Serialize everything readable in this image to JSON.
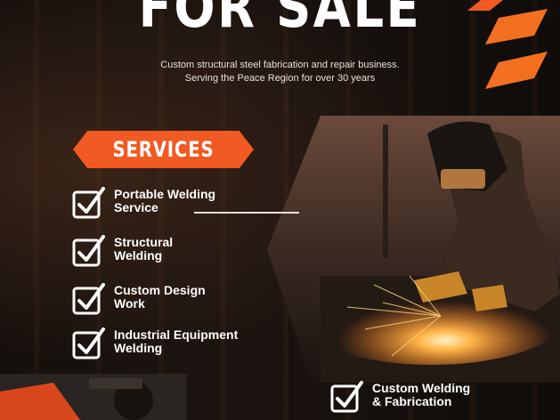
{
  "poster": {
    "headline": "FOR SALE",
    "description_line1": "Custom structural steel fabrication and repair business.",
    "description_line2": "Serving the Peace Region for over 30 years",
    "services_badge": "SERVICES",
    "services": [
      {
        "line1": "Portable Welding",
        "line2": "Service"
      },
      {
        "line1": "Structural",
        "line2": "Welding"
      },
      {
        "line1": "Custom Design",
        "line2": "Work"
      },
      {
        "line1": "Industrial Equipment",
        "line2": "Welding"
      },
      {
        "line1": "Custom Welding",
        "line2": "& Fabrication"
      }
    ]
  },
  "colors": {
    "accent": "#f15a22",
    "text": "#ffffff",
    "background": "#0d0b0a"
  },
  "icons": [
    "checkbox-check-icon"
  ]
}
